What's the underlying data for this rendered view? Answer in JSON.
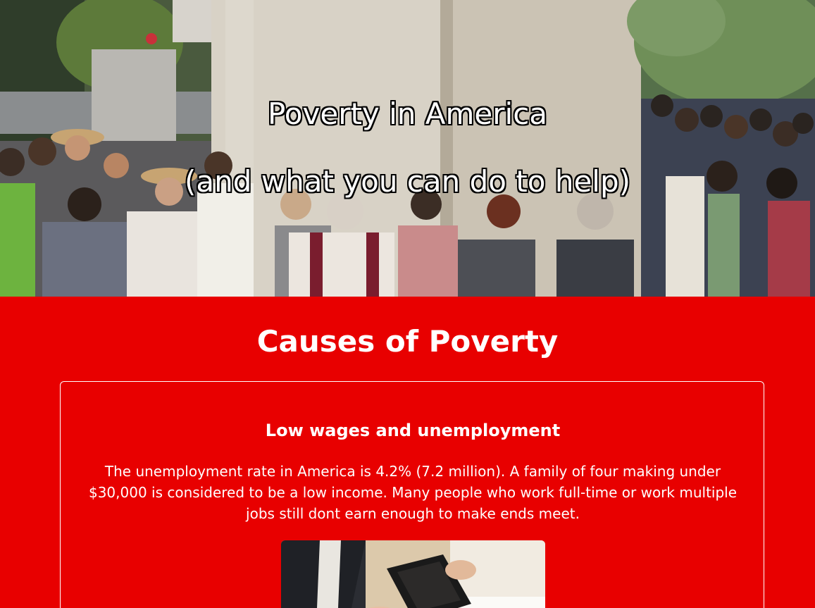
{
  "hero": {
    "title": "Poverty in America",
    "subtitle": "(and what you can do to help)",
    "image": "people-waiting-in-food-line-photo"
  },
  "causes": {
    "background_color": "#e80000",
    "heading": "Causes of Poverty",
    "cards": [
      {
        "title": "Low wages and unemployment",
        "text": "The unemployment rate in America is 4.2% (7.2 million). A family of four making under $30,000 is considered to be a low income. Many people who work full-time or work multiple jobs still dont earn enough to make ends meet.",
        "image": "empty-wallet-photo"
      }
    ]
  }
}
